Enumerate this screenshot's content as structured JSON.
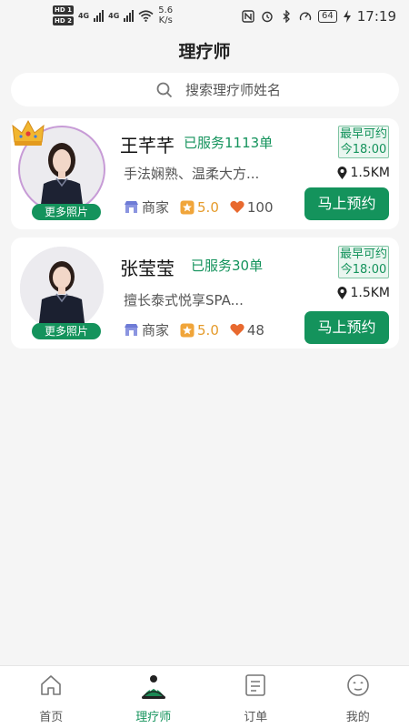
{
  "status_bar": {
    "network_speed_value": "5.6",
    "network_speed_unit": "K/s",
    "battery": "64",
    "time": "17:19"
  },
  "header": {
    "title": "理疗师"
  },
  "search": {
    "placeholder": "搜索理疗师姓名"
  },
  "therapists": [
    {
      "name": "王芊芊",
      "served": "已服务1113单",
      "description": "手法娴熟、温柔大方...",
      "category": "商家",
      "rating": "5.0",
      "likes": "100",
      "more_photos": "更多照片",
      "earliest_label": "最早可约",
      "earliest_time": "今18:00",
      "distance": "1.5KM",
      "book_label": "马上预约"
    },
    {
      "name": "张莹莹",
      "served": "已服务30单",
      "description": "擅长泰式悦享SPA...",
      "category": "商家",
      "rating": "5.0",
      "likes": "48",
      "more_photos": "更多照片",
      "earliest_label": "最早可约",
      "earliest_time": "今18:00",
      "distance": "1.5KM",
      "book_label": "马上预约"
    }
  ],
  "tabs": [
    {
      "label": "首页",
      "icon": "home-icon",
      "active": false
    },
    {
      "label": "理疗师",
      "icon": "therapist-icon",
      "active": true
    },
    {
      "label": "订单",
      "icon": "orders-icon",
      "active": false
    },
    {
      "label": "我的",
      "icon": "profile-icon",
      "active": false
    }
  ],
  "colors": {
    "accent": "#14935c",
    "rating": "#e59b2b",
    "heart": "#e8692f"
  }
}
